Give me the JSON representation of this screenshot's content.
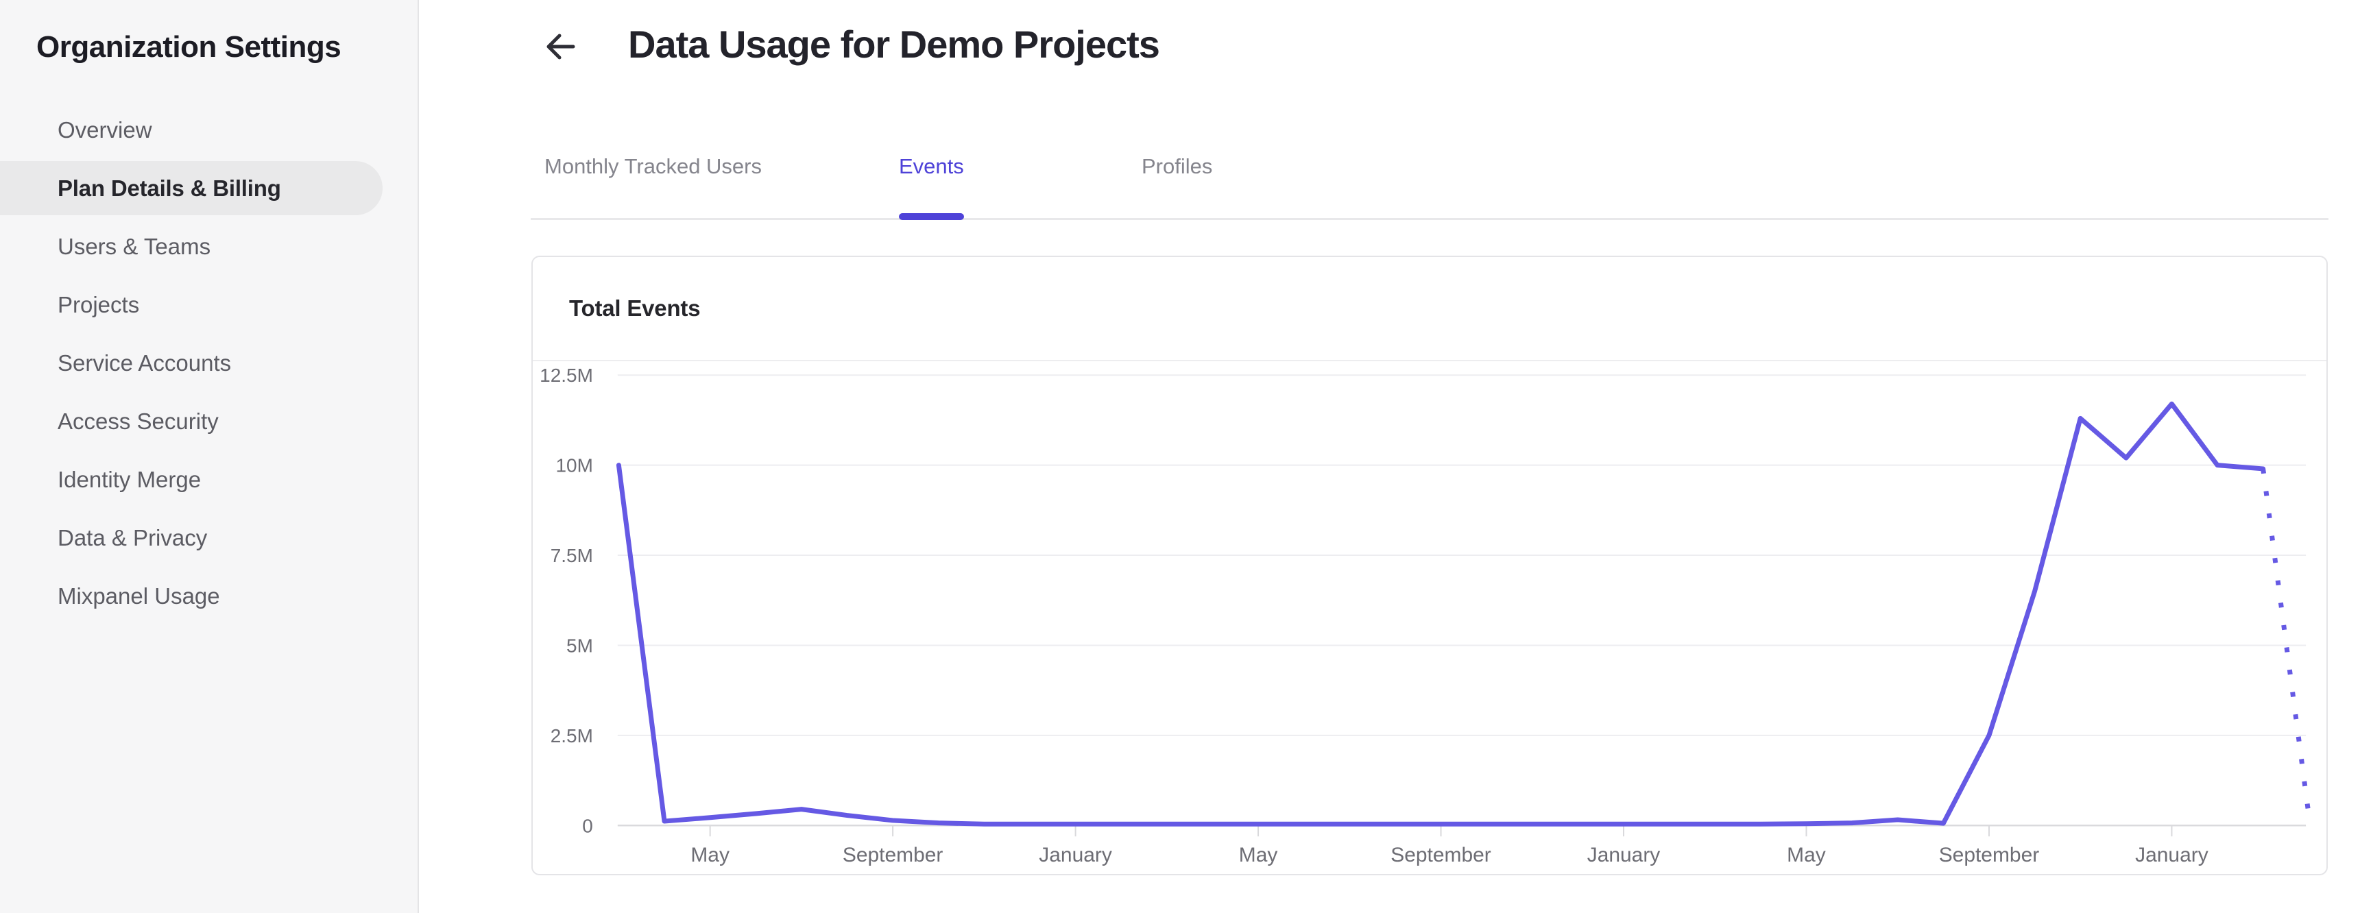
{
  "sidebar": {
    "title": "Organization Settings",
    "items": [
      {
        "label": "Overview",
        "active": false
      },
      {
        "label": "Plan Details & Billing",
        "active": true
      },
      {
        "label": "Users & Teams",
        "active": false
      },
      {
        "label": "Projects",
        "active": false
      },
      {
        "label": "Service Accounts",
        "active": false
      },
      {
        "label": "Access Security",
        "active": false
      },
      {
        "label": "Identity Merge",
        "active": false
      },
      {
        "label": "Data & Privacy",
        "active": false
      },
      {
        "label": "Mixpanel Usage",
        "active": false
      }
    ]
  },
  "header": {
    "title": "Data Usage for Demo Projects",
    "back_icon": "arrow-left-icon"
  },
  "tabs": [
    {
      "label": "Monthly Tracked Users",
      "active": false
    },
    {
      "label": "Events",
      "active": true
    },
    {
      "label": "Profiles",
      "active": false
    }
  ],
  "colors": {
    "accent": "#4e42d8",
    "line": "#6559e4",
    "sidebar_bg": "#f6f6f7",
    "active_pill": "#e9e9ea",
    "grid": "#ededf0",
    "axis": "#d9d9dc",
    "axis_label": "#6d6d74"
  },
  "chart_data": {
    "type": "line",
    "title": "Total Events",
    "xlabel": "",
    "ylabel": "",
    "unit": "events (millions)",
    "ylim": [
      0,
      12.5
    ],
    "grid": true,
    "legend": "none",
    "y_ticks": [
      {
        "label": "12.5M",
        "value": 12.5
      },
      {
        "label": "10M",
        "value": 10
      },
      {
        "label": "7.5M",
        "value": 7.5
      },
      {
        "label": "5M",
        "value": 5
      },
      {
        "label": "2.5M",
        "value": 2.5
      },
      {
        "label": "0",
        "value": 0
      }
    ],
    "x_ticks": [
      {
        "label": "May",
        "index": 2
      },
      {
        "label": "September",
        "index": 6
      },
      {
        "label": "January",
        "index": 10
      },
      {
        "label": "May",
        "index": 14
      },
      {
        "label": "September",
        "index": 18
      },
      {
        "label": "January",
        "index": 22
      },
      {
        "label": "May",
        "index": 26
      },
      {
        "label": "September",
        "index": 30
      },
      {
        "label": "January",
        "index": 34
      }
    ],
    "series": [
      {
        "name": "Total Events",
        "values_millions": [
          10,
          0.12,
          0.22,
          0.33,
          0.45,
          0.28,
          0.14,
          0.07,
          0.04,
          0.04,
          0.04,
          0.04,
          0.04,
          0.04,
          0.04,
          0.04,
          0.04,
          0.04,
          0.04,
          0.04,
          0.04,
          0.04,
          0.04,
          0.04,
          0.04,
          0.04,
          0.05,
          0.07,
          0.16,
          0.06,
          2.5,
          6.5,
          11.3,
          10.2,
          11.7,
          10.0,
          9.9,
          0.3
        ],
        "last_segment_projected_dotted": true
      }
    ]
  }
}
